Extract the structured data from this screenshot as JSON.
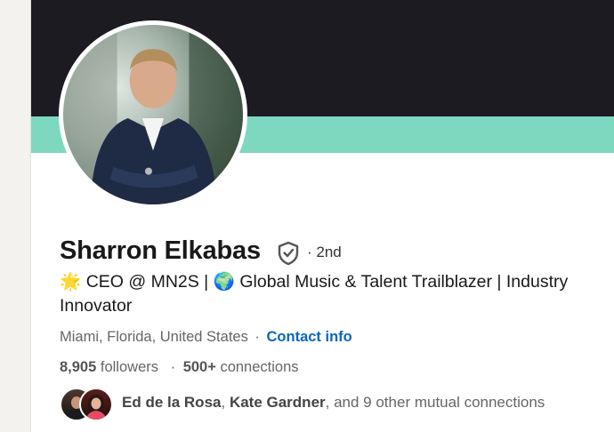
{
  "profile": {
    "name": "Sharron Elkabas",
    "degree": "· 2nd",
    "headline_star": "🌟",
    "headline_part1": " CEO @ MN2S | ",
    "headline_globe": "🌍",
    "headline_part2": " Global Music & Talent Trailblazer | Industry Innovator",
    "location": "Miami, Florida, United States",
    "location_separator": "·",
    "contact_info": "Contact info",
    "followers_count": "8,905",
    "followers_label": " followers",
    "stats_separator": "·",
    "connections_count": "500+",
    "connections_label": " connections",
    "mutual_name1": "Ed de la Rosa",
    "mutual_comma": ", ",
    "mutual_name2": "Kate Gardner",
    "mutual_rest": ", and 9 other mutual connections"
  },
  "colors": {
    "banner_dark": "#1d1b22",
    "banner_accent": "#7ed8c0",
    "link": "#0a66c2"
  },
  "icons": {
    "verification": "shield-check-icon"
  }
}
